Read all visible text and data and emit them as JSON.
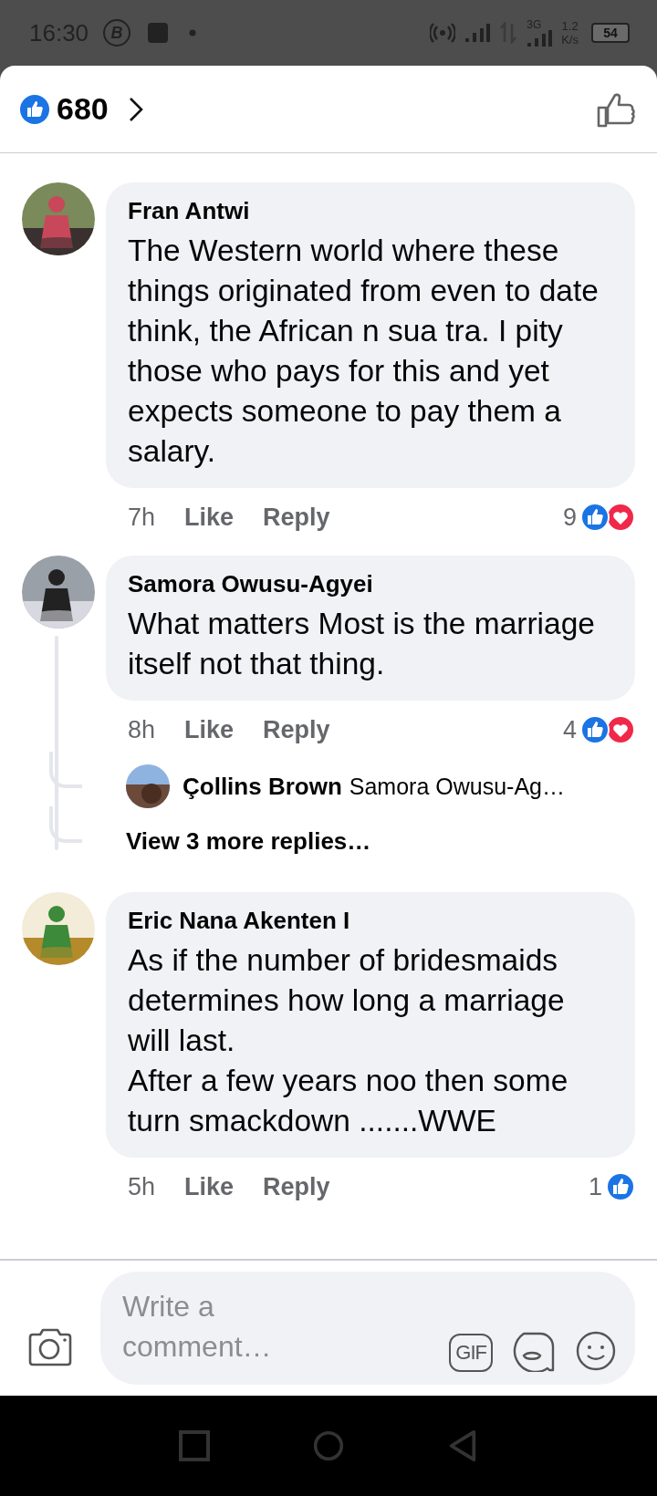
{
  "status_bar": {
    "time": "16:30",
    "app_badge": "B",
    "network": "3G",
    "speed_value": "1.2",
    "speed_unit": "K/s",
    "battery": "54"
  },
  "header": {
    "count": "680"
  },
  "comments": [
    {
      "author": "Fran Antwi",
      "text": "The Western world where these things originated from even to date think, the African n sua tra. I pity those who pays for this and yet expects someone to pay them a salary.",
      "time": "7h",
      "like": "Like",
      "reply": "Reply",
      "reaction_count": "9",
      "reactions": [
        {
          "kind": "like"
        },
        {
          "kind": "love"
        }
      ]
    },
    {
      "author": "Samora Owusu-Agyei",
      "text": "What matters Most is the marriage itself not that thing.",
      "time": "8h",
      "like": "Like",
      "reply": "Reply",
      "reaction_count": "4",
      "reactions": [
        {
          "kind": "like"
        },
        {
          "kind": "love"
        }
      ],
      "replies": {
        "author": "Çollins Brown",
        "text": "Samora Owusu-Ag…",
        "more": "View 3 more replies…"
      }
    },
    {
      "author": "Eric Nana Akenten I",
      "text": "As if the number of bridesmaids determines how long a marriage will last.\nAfter a few years noo then some turn smackdown .......WWE",
      "time": "5h",
      "like": "Like",
      "reply": "Reply",
      "reaction_count": "1",
      "reactions": [
        {
          "kind": "like"
        }
      ]
    }
  ],
  "composer": {
    "placeholder": "Write a comment…",
    "gif": "GIF"
  }
}
